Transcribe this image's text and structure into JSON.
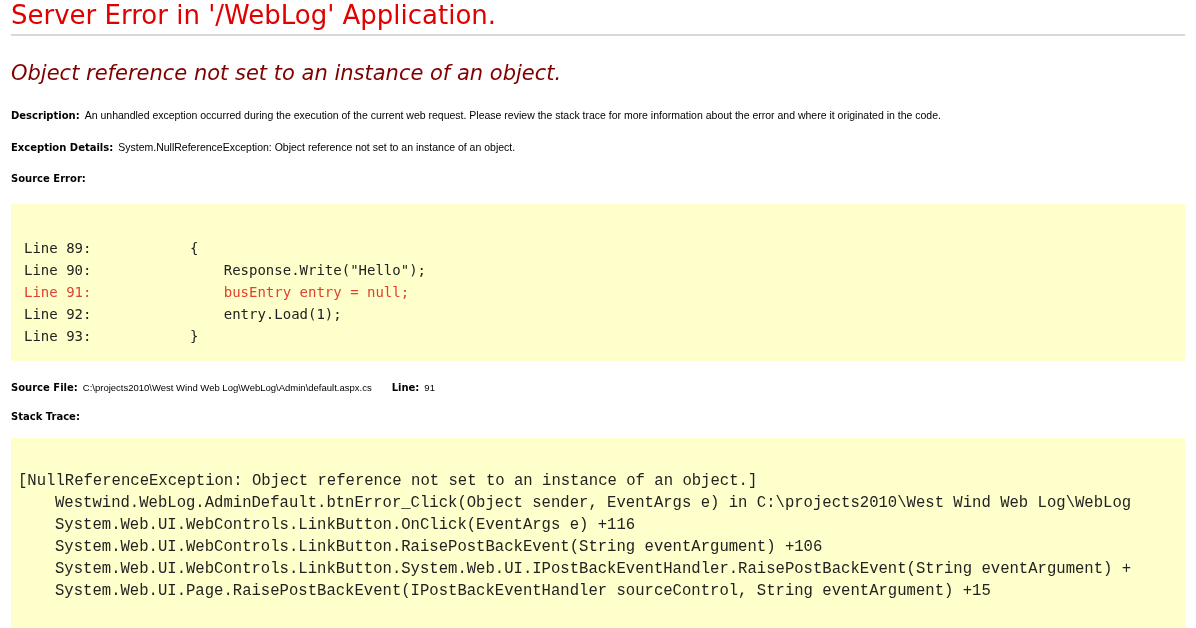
{
  "title": "Server Error in '/WebLog' Application.",
  "message": "Object reference not set to an instance of an object.",
  "description": {
    "label": "Description:",
    "text": "An unhandled exception occurred during the execution of the current web request. Please review the stack trace for more information about the error and where it originated in the code."
  },
  "exception_details": {
    "label": "Exception Details:",
    "text": "System.NullReferenceException: Object reference not set to an instance of an object."
  },
  "source_error": {
    "label": "Source Error:",
    "lines": [
      {
        "number": "Line 89:",
        "code": "{",
        "highlighted": false
      },
      {
        "number": "Line 90:",
        "code": "    Response.Write(\"Hello\");",
        "highlighted": false
      },
      {
        "number": "Line 91:",
        "code": "    busEntry entry = null;",
        "highlighted": true
      },
      {
        "number": "Line 92:",
        "code": "    entry.Load(1);",
        "highlighted": false
      },
      {
        "number": "Line 93:",
        "code": "}",
        "highlighted": false
      }
    ]
  },
  "source_file": {
    "label": "Source File:",
    "path": "C:\\projects2010\\West Wind Web Log\\WebLog\\Admin\\default.aspx.cs",
    "line_label": "Line:",
    "line": "91"
  },
  "stack_trace": {
    "label": "Stack Trace:",
    "lines": [
      {
        "kind": "exception",
        "text": "[NullReferenceException: Object reference not set to an instance of an object.]"
      },
      {
        "kind": "frame",
        "text": "Westwind.WebLog.AdminDefault.btnError_Click(Object sender, EventArgs e) in C:\\projects2010\\West Wind Web Log\\WebLog"
      },
      {
        "kind": "frame",
        "text": "System.Web.UI.WebControls.LinkButton.OnClick(EventArgs e) +116"
      },
      {
        "kind": "frame",
        "text": "System.Web.UI.WebControls.LinkButton.RaisePostBackEvent(String eventArgument) +106"
      },
      {
        "kind": "frame",
        "text": "System.Web.UI.WebControls.LinkButton.System.Web.UI.IPostBackEventHandler.RaisePostBackEvent(String eventArgument) +"
      },
      {
        "kind": "frame",
        "text": "System.Web.UI.Page.RaisePostBackEvent(IPostBackEventHandler sourceControl, String eventArgument) +15"
      }
    ]
  }
}
